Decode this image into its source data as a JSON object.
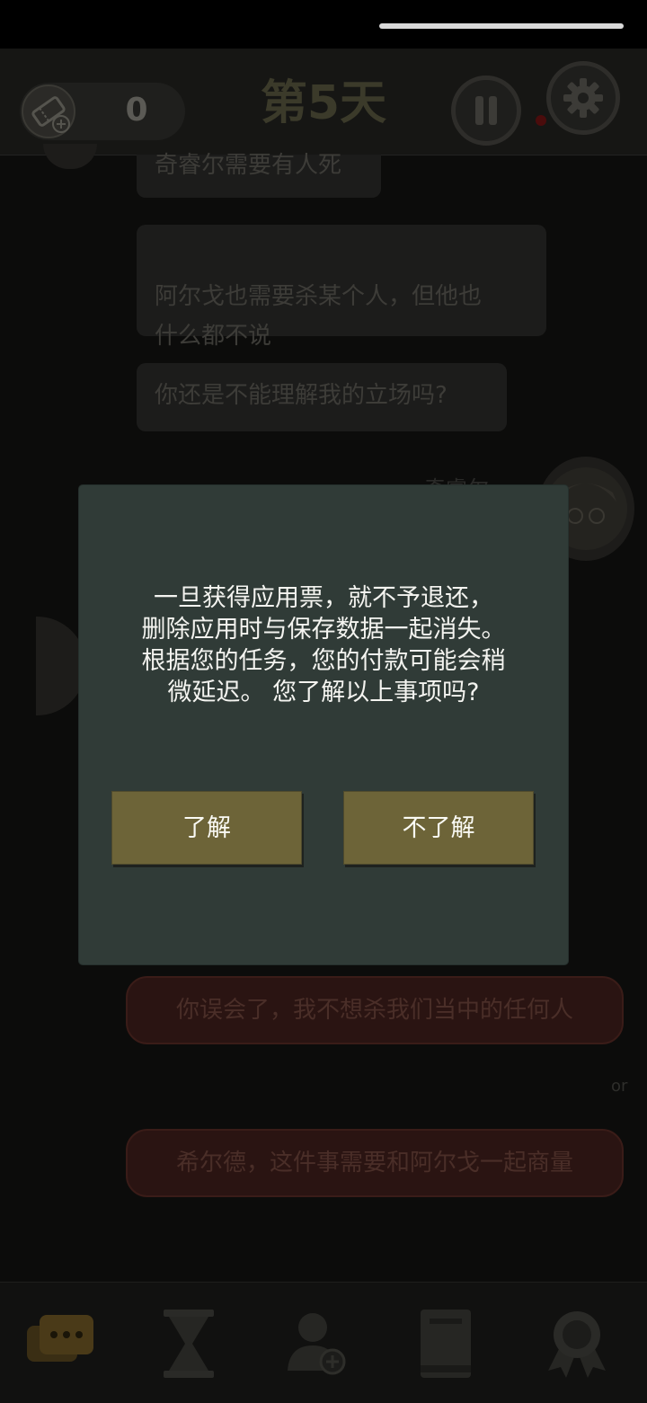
{
  "header": {
    "ticket_count": "0",
    "day_title": "第5天"
  },
  "chat": {
    "messages": [
      "奇睿尔需要有人死",
      "阿尔戈也需要杀某个人，但他也\n什么都不说",
      "你还是不能理解我的立场吗?"
    ],
    "speaker_name": "奇睿尔"
  },
  "choices": {
    "option_1": "你误会了，我不想杀我们当中的任何人",
    "or_label": "or",
    "option_2": "希尔德，这件事需要和阿尔戈一起商量"
  },
  "dialog": {
    "message": "一旦获得应用票，就不予退还，\n删除应用时与保存数据一起消失。\n根据您的任务，您的付款可能会稍\n微延迟。 您了解以上事项吗?",
    "confirm_label": "了解",
    "decline_label": "不了解"
  },
  "colors": {
    "modal_bg": "#303b37",
    "button_bg": "#6d6438",
    "choice_bg": "#2a1412"
  },
  "nav": {
    "items": [
      "chat-icon",
      "hourglass-icon",
      "add-person-icon",
      "book-icon",
      "badge-icon"
    ]
  }
}
